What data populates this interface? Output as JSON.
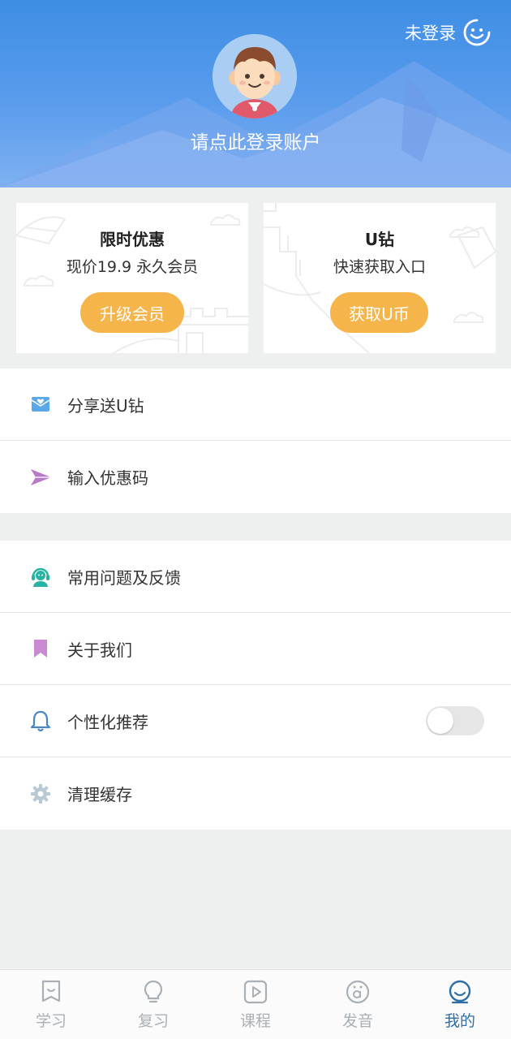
{
  "header": {
    "login_status": "未登录",
    "login_prompt": "请点此登录账户"
  },
  "cards": [
    {
      "title": "限时优惠",
      "subtitle": "现价19.9 永久会员",
      "button": "升级会员"
    },
    {
      "title": "U钻",
      "subtitle": "快速获取入口",
      "button": "获取U币"
    }
  ],
  "menu_group_1": [
    {
      "label": "分享送U钻",
      "icon": "share-gift-icon"
    },
    {
      "label": "输入优惠码",
      "icon": "paper-plane-icon"
    }
  ],
  "menu_group_2": [
    {
      "label": "常用问题及反馈",
      "icon": "support-agent-icon"
    },
    {
      "label": "关于我们",
      "icon": "bookmark-icon"
    },
    {
      "label": "个性化推荐",
      "icon": "bell-icon",
      "toggle_on": false
    },
    {
      "label": "清理缓存",
      "icon": "gear-icon"
    }
  ],
  "bottom_nav": [
    {
      "label": "学习",
      "icon": "bookmark-study-icon",
      "active": false
    },
    {
      "label": "复习",
      "icon": "lightbulb-icon",
      "active": false
    },
    {
      "label": "课程",
      "icon": "play-icon",
      "active": false
    },
    {
      "label": "发音",
      "icon": "umlaut-a-icon",
      "active": false
    },
    {
      "label": "我的",
      "icon": "profile-smile-icon",
      "active": true
    }
  ],
  "colors": {
    "header_blue": "#3d8ee4",
    "accent_orange": "#f5b54a",
    "active_nav": "#2f6ea5"
  }
}
